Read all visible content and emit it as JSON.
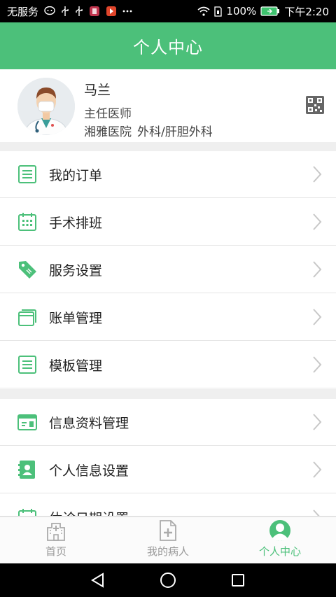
{
  "status_bar": {
    "carrier": "无服务",
    "battery": "100%",
    "time": "下午2:20"
  },
  "header": {
    "title": "个人中心"
  },
  "profile": {
    "name": "马兰",
    "title": "主任医师",
    "hospital": "湘雅医院",
    "department": "外科/肝胆外科"
  },
  "menu_group1": [
    {
      "label": "我的订单",
      "icon": "list-icon"
    },
    {
      "label": "手术排班",
      "icon": "calendar-icon"
    },
    {
      "label": "服务设置",
      "icon": "tag-icon"
    },
    {
      "label": "账单管理",
      "icon": "cards-icon"
    },
    {
      "label": "模板管理",
      "icon": "template-icon"
    }
  ],
  "menu_group2": [
    {
      "label": "信息资料管理",
      "icon": "id-card-icon"
    },
    {
      "label": "个人信息设置",
      "icon": "contact-book-icon"
    },
    {
      "label": "休诊日期设置",
      "icon": "calendar-icon"
    }
  ],
  "tabs": [
    {
      "label": "首页",
      "icon": "hospital-icon",
      "active": false
    },
    {
      "label": "我的病人",
      "icon": "medical-file-icon",
      "active": false
    },
    {
      "label": "个人中心",
      "icon": "person-icon",
      "active": true
    }
  ],
  "colors": {
    "accent": "#4cc07a",
    "separator": "#efefef"
  }
}
